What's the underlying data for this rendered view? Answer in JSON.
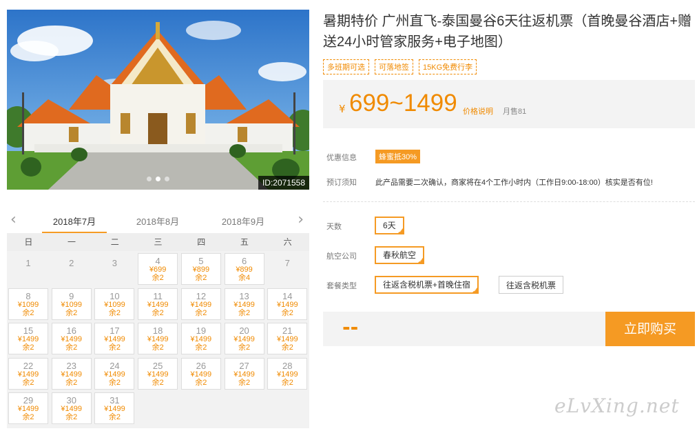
{
  "gallery": {
    "image_id": "ID:2071558",
    "dots": 3,
    "active_dot": 1
  },
  "calendar": {
    "months": [
      "2018年7月",
      "2018年8月",
      "2018年9月"
    ],
    "active_month": 0,
    "prev_icon": "chevron-left-icon",
    "next_icon": "chevron-right-icon",
    "weekdays": [
      "日",
      "一",
      "二",
      "三",
      "四",
      "五",
      "六"
    ],
    "first_weekday": 0,
    "days": [
      {
        "d": "1"
      },
      {
        "d": "2"
      },
      {
        "d": "3"
      },
      {
        "d": "4",
        "p": "¥699",
        "r": "余2"
      },
      {
        "d": "5",
        "p": "¥899",
        "r": "余2"
      },
      {
        "d": "6",
        "p": "¥899",
        "r": "余4"
      },
      {
        "d": "7"
      },
      {
        "d": "8",
        "p": "¥1099",
        "r": "余2"
      },
      {
        "d": "9",
        "p": "¥1099",
        "r": "余2"
      },
      {
        "d": "10",
        "p": "¥1099",
        "r": "余2"
      },
      {
        "d": "11",
        "p": "¥1499",
        "r": "余2"
      },
      {
        "d": "12",
        "p": "¥1499",
        "r": "余2"
      },
      {
        "d": "13",
        "p": "¥1499",
        "r": "余2"
      },
      {
        "d": "14",
        "p": "¥1499",
        "r": "余2"
      },
      {
        "d": "15",
        "p": "¥1499",
        "r": "余2"
      },
      {
        "d": "16",
        "p": "¥1499",
        "r": "余2"
      },
      {
        "d": "17",
        "p": "¥1499",
        "r": "余2"
      },
      {
        "d": "18",
        "p": "¥1499",
        "r": "余2"
      },
      {
        "d": "19",
        "p": "¥1499",
        "r": "余2"
      },
      {
        "d": "20",
        "p": "¥1499",
        "r": "余2"
      },
      {
        "d": "21",
        "p": "¥1499",
        "r": "余2"
      },
      {
        "d": "22",
        "p": "¥1499",
        "r": "余2"
      },
      {
        "d": "23",
        "p": "¥1499",
        "r": "余2"
      },
      {
        "d": "24",
        "p": "¥1499",
        "r": "余2"
      },
      {
        "d": "25",
        "p": "¥1499",
        "r": "余2"
      },
      {
        "d": "26",
        "p": "¥1499",
        "r": "余2"
      },
      {
        "d": "27",
        "p": "¥1499",
        "r": "余2"
      },
      {
        "d": "28",
        "p": "¥1499",
        "r": "余2"
      },
      {
        "d": "29",
        "p": "¥1499",
        "r": "余2"
      },
      {
        "d": "30",
        "p": "¥1499",
        "r": "余2"
      },
      {
        "d": "31",
        "p": "¥1499",
        "r": "余2"
      }
    ]
  },
  "product": {
    "title": "暑期特价 广州直飞-泰国曼谷6天往返机票（首晚曼谷酒店+赠送24小时管家服务+电子地图）",
    "tags": [
      "多班期可选",
      "可落地签",
      "15KG免费行李"
    ],
    "currency": "¥",
    "price_range": "699~1499",
    "price_explain": "价格说明",
    "monthly_sales": "月售81"
  },
  "info": {
    "promo_label": "优惠信息",
    "promo_badge": "蜂蜜抵30%",
    "notice_label": "预订须知",
    "notice_text": "此产品需要二次确认，商家将在4个工作小时内（工作日9:00-18:00）核实是否有位!"
  },
  "options": {
    "days_label": "天数",
    "days_value": "6天",
    "airline_label": "航空公司",
    "airline_value": "春秋航空",
    "package_label": "套餐类型",
    "package_options": [
      "往返含税机票+首晚住宿",
      "往返含税机票"
    ],
    "package_selected": 0
  },
  "purchase": {
    "total_placeholder": "--",
    "buy_label": "立即购买"
  },
  "watermark": "eLvXing.net",
  "colors": {
    "accent": "#f59a23",
    "price": "#f08a00",
    "panel": "#f3f3f3"
  }
}
